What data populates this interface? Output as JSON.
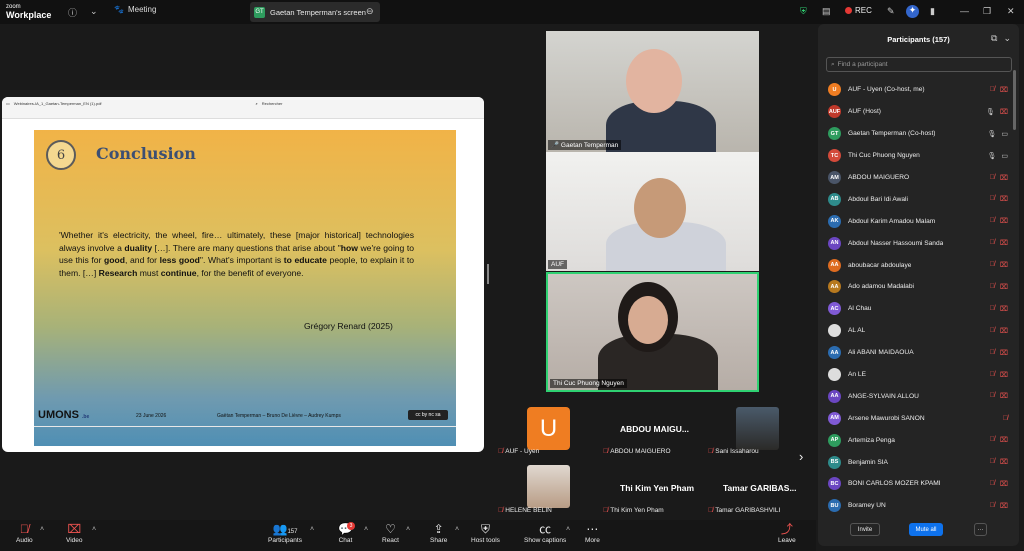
{
  "app": {
    "brand_small": "zoom",
    "brand_large": "Workplace"
  },
  "topbar": {
    "meeting_label": "Meeting",
    "screen_tab_initials": "GT",
    "screen_tab_label": "Gaetan Temperman's screen",
    "rec_label": "REC"
  },
  "pdf": {
    "filename": "Webinaires-IA_1_Gaetan-Temperman_EN (1).pdf",
    "search_placeholder": "Rechercher"
  },
  "slide": {
    "number": "6",
    "title": "Conclusion",
    "quote_parts": [
      "'Whether it's electricity, the wheel, fire… ultimately, these [major historical] technologies always involve a ",
      "duality",
      " […]. There are many questions that arise about \"",
      "how",
      " we're going to use this for ",
      "good",
      ", and for ",
      "less good",
      "\". What's important is ",
      "to educate",
      " people, to explain it to them. […] ",
      "Research",
      " must ",
      "continue",
      ", for the benefit of everyone."
    ],
    "author": "Grégory Renard (2025)",
    "footer_logo": "UMONS",
    "footer_logo_suffix": ".be",
    "footer_date": "23 June 2026",
    "footer_authors": "Gaëtan Temperman – Bruno De Lièvre – Audrey Kumps",
    "footer_cc": "cc by nc sa"
  },
  "videos": [
    {
      "name": "Gaetan Temperman"
    },
    {
      "name": "AUF"
    },
    {
      "name": "Thi Cuc Phuong Nguyen"
    }
  ],
  "thumbs": {
    "auf_initial": "U",
    "auf_label": "AUF - Uyen",
    "abdou_big": "ABDOU MAIGU...",
    "abdou_label": "ABDOU MAIGUERO",
    "sani_label": "Sani Issaharou",
    "helene_label": "HELENE BELIN",
    "thikim_big": "Thi Kim Yen Pham",
    "thikim_label": "Thi Kim Yen Pham",
    "tamar_big": "Tamar GARIBAS...",
    "tamar_label": "Tamar GARIBASHVILI"
  },
  "toolbar": {
    "audio": "Audio",
    "video": "Video",
    "participants": "Participants",
    "participants_count": "157",
    "chat": "Chat",
    "chat_badge": "3",
    "react": "React",
    "share": "Share",
    "host_tools": "Host tools",
    "captions": "Show captions",
    "more": "More",
    "leave": "Leave"
  },
  "panel": {
    "title": "Participants (157)",
    "search_placeholder": "Find a participant",
    "invite": "Invite",
    "mute_all": "Mute all",
    "more": "···",
    "participants": [
      {
        "initials": "U",
        "name": "AUF - Uyen (Co-host, me)",
        "color": "#ef7d22",
        "mic": "off",
        "video": "off"
      },
      {
        "initials": "AUF",
        "name": "AUF (Host)",
        "color": "#c0392b",
        "mic": "on",
        "video": "off"
      },
      {
        "initials": "GT",
        "name": "Gaetan Temperman (Co-host)",
        "color": "#2e9c5e",
        "mic": "on",
        "video": "on"
      },
      {
        "initials": "TC",
        "name": "Thi Cuc Phuong Nguyen",
        "color": "#d34a3a",
        "mic": "on",
        "video": "on"
      },
      {
        "initials": "AM",
        "name": "ABDOU MAIGUERO",
        "color": "#4a5568",
        "mic": "off",
        "video": "off"
      },
      {
        "initials": "AB",
        "name": "Abdoul Bari Idi Awali",
        "color": "#2e8b8b",
        "mic": "off",
        "video": "off"
      },
      {
        "initials": "AK",
        "name": "Abdoul Karim Amadou Malam",
        "color": "#2b6cb0",
        "mic": "off",
        "video": "off"
      },
      {
        "initials": "AN",
        "name": "Abdoul Nasser Hassoumi Sanda",
        "color": "#6b46c1",
        "mic": "off",
        "video": "off"
      },
      {
        "initials": "AA",
        "name": "aboubacar abdoulaye",
        "color": "#dd6b20",
        "mic": "off",
        "video": "off"
      },
      {
        "initials": "AA",
        "name": "Ado adamou Madalabi",
        "color": "#b7791f",
        "mic": "off",
        "video": "off"
      },
      {
        "initials": "AC",
        "name": "Al Chau",
        "color": "#805ad5",
        "mic": "off",
        "video": "off"
      },
      {
        "initials": "",
        "name": "AL AL",
        "color": "#ddd",
        "mic": "off",
        "video": "off"
      },
      {
        "initials": "AA",
        "name": "Ali ABANI MAIDAOUA",
        "color": "#2b6cb0",
        "mic": "off",
        "video": "off"
      },
      {
        "initials": "",
        "name": "An LE",
        "color": "#ddd",
        "mic": "off",
        "video": "off"
      },
      {
        "initials": "AA",
        "name": "ANGE-SYLVAIN ALLOU",
        "color": "#6b46c1",
        "mic": "off",
        "video": "off"
      },
      {
        "initials": "AM",
        "name": "Arsene Mawurobi SANON",
        "color": "#805ad5",
        "mic": "off",
        "video": ""
      },
      {
        "initials": "AP",
        "name": "Artemiza Penga",
        "color": "#2e9c5e",
        "mic": "off",
        "video": "off"
      },
      {
        "initials": "BS",
        "name": "Benjamin SIA",
        "color": "#2e8b8b",
        "mic": "off",
        "video": "off"
      },
      {
        "initials": "BC",
        "name": "BONI CARLOS MOZER KPAMI",
        "color": "#6b46c1",
        "mic": "off",
        "video": "off"
      },
      {
        "initials": "BU",
        "name": "Boramey UN",
        "color": "#2b6cb0",
        "mic": "off",
        "video": "off"
      }
    ]
  }
}
